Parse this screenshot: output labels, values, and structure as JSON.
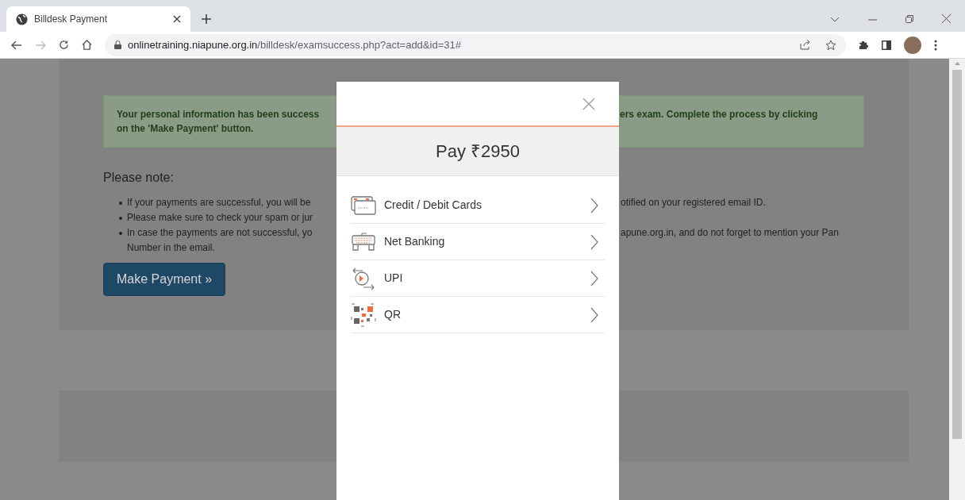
{
  "browser": {
    "tab": {
      "title": "Billdesk Payment",
      "selected": true
    },
    "url": {
      "domain": "onlinetraining.niapune.org.in",
      "path": "/billdesk/examsuccess.php?act=add&id=31#"
    }
  },
  "page": {
    "alert": {
      "left_lines": [
        "Your personal information has been success",
        "on the 'Make Payment' button."
      ],
      "right_lines": [
        "ers exam. Complete the process by clicking"
      ]
    },
    "note_heading": "Please note:",
    "bullets": [
      {
        "left": [
          "If your payments are successful, you will be"
        ],
        "right": "otified on your registered email ID."
      },
      {
        "left": [
          "Please make sure to check your spam or jur"
        ]
      },
      {
        "left": [
          "In case the payments are not successful, yo",
          "Number in the email."
        ],
        "right": "apune.org.in, and do not forget to mention your Pan"
      }
    ],
    "button": "Make Payment »"
  },
  "modal": {
    "amount": "Pay ₹2950",
    "options": [
      {
        "kind": "card",
        "label": "Credit / Debit Cards"
      },
      {
        "kind": "netbanking",
        "label": "Net Banking"
      },
      {
        "kind": "upi",
        "label": "UPI"
      },
      {
        "kind": "qr",
        "label": "QR"
      }
    ]
  }
}
